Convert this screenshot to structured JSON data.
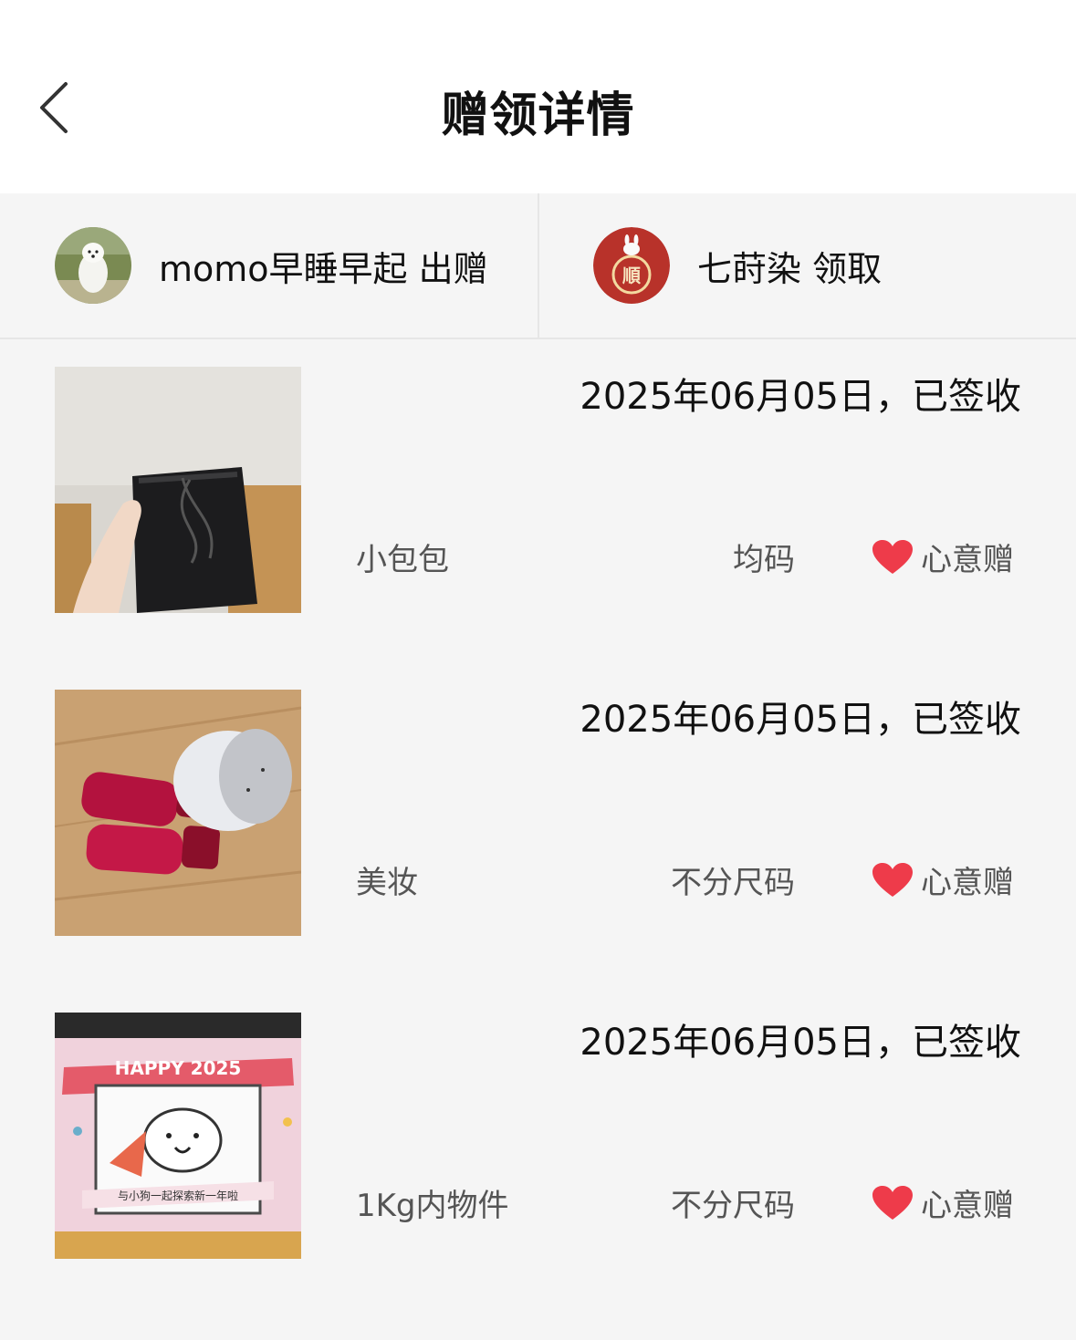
{
  "header": {
    "title": "赠领详情"
  },
  "parties": {
    "giver": {
      "text": "momo早睡早起 出赠"
    },
    "receiver": {
      "text": "七莳染 领取"
    }
  },
  "items": [
    {
      "date_status": "2025年06月05日，已签收",
      "name": "小包包",
      "size": "均码",
      "type": "心意赠"
    },
    {
      "date_status": "2025年06月05日，已签收",
      "name": "美妆",
      "size": "不分尺码",
      "type": "心意赠"
    },
    {
      "date_status": "2025年06月05日，已签收",
      "name": "1Kg内物件",
      "size": "不分尺码",
      "type": "心意赠"
    }
  ],
  "thumb3_text": {
    "banner": "HAPPY 2025",
    "caption": "与小狗一起探索新一年啦"
  },
  "colors": {
    "accent_heart": "#ee3b4a",
    "background": "#f5f5f5",
    "divider": "#e6e6e6"
  },
  "icons": {
    "back": "chevron-left-icon",
    "heart": "heart-icon"
  }
}
